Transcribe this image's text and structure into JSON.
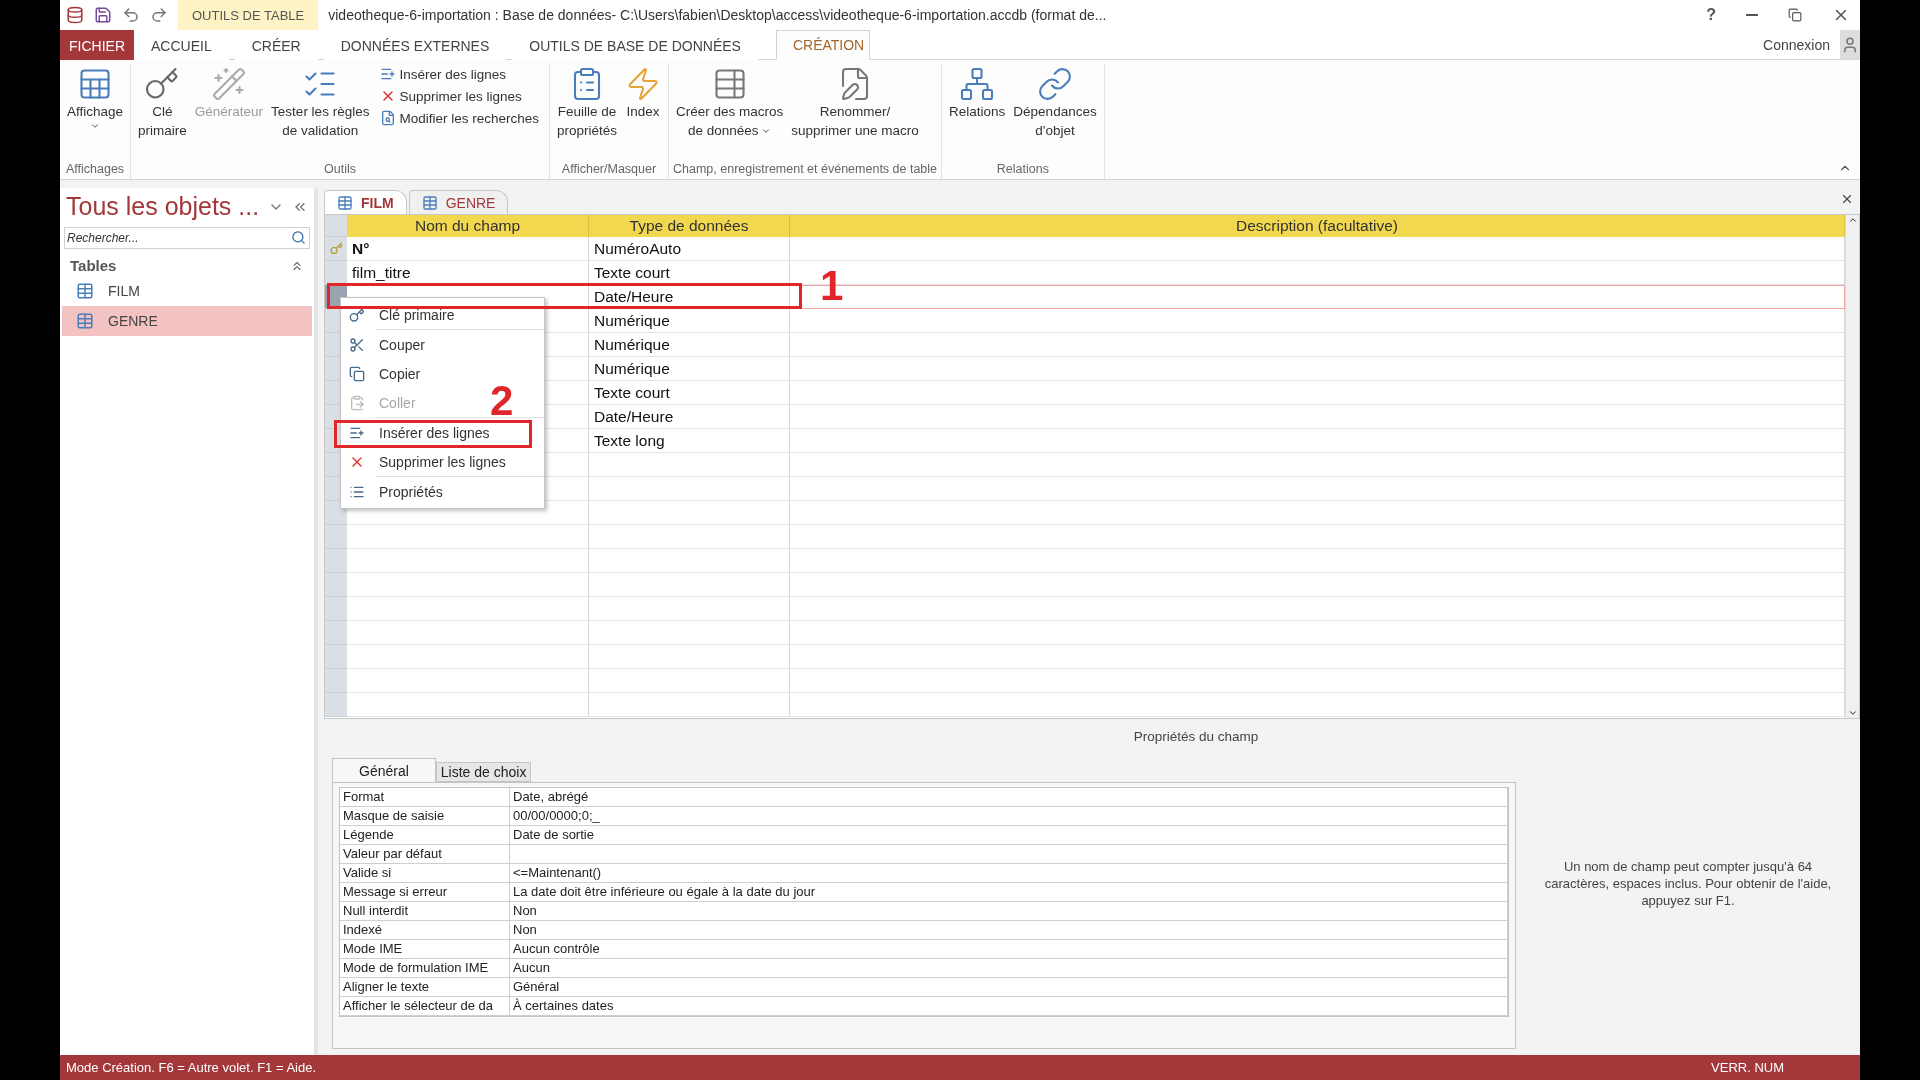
{
  "title_bar": {
    "contextual_tab": "OUTILS DE TABLE",
    "title": "videotheque-6-importation : Base de données- C:\\Users\\fabien\\Desktop\\access\\videotheque-6-importation.accdb (format de...",
    "help": "?"
  },
  "ribbon_tabs": [
    {
      "label": "FICHIER",
      "kind": "file",
      "selected": false
    },
    {
      "label": "ACCUEIL",
      "kind": "tab",
      "selected": false
    },
    {
      "label": "CRÉER",
      "kind": "tab",
      "selected": false
    },
    {
      "label": "DONNÉES EXTERNES",
      "kind": "tab",
      "selected": false
    },
    {
      "label": "OUTILS DE BASE DE DONNÉES",
      "kind": "tab",
      "selected": false
    },
    {
      "label": "CRÉATION",
      "kind": "contextual",
      "selected": true
    }
  ],
  "account": "Connexion",
  "ribbon_groups": [
    {
      "label": "Affichages",
      "buttons": [
        {
          "kind": "large",
          "lines": [
            "Affichage"
          ],
          "dropdown": true,
          "disabled": false
        }
      ]
    },
    {
      "label": "Outils",
      "buttons": [
        {
          "kind": "large",
          "lines": [
            "Clé",
            "primaire"
          ],
          "disabled": false
        },
        {
          "kind": "large",
          "lines": [
            "Générateur"
          ],
          "disabled": true
        },
        {
          "kind": "large",
          "lines": [
            "Tester les règles",
            "de validation"
          ],
          "disabled": false
        },
        {
          "kind": "small",
          "lines": [
            "Insérer des lignes"
          ],
          "disabled": false
        },
        {
          "kind": "small",
          "lines": [
            "Supprimer les lignes"
          ],
          "disabled": false
        },
        {
          "kind": "small",
          "lines": [
            "Modifier les recherches"
          ],
          "disabled": false
        }
      ]
    },
    {
      "label": "Afficher/Masquer",
      "buttons": [
        {
          "kind": "large",
          "lines": [
            "Feuille de",
            "propriétés"
          ],
          "disabled": false
        },
        {
          "kind": "large",
          "lines": [
            "Index"
          ],
          "disabled": false
        }
      ]
    },
    {
      "label": "Champ, enregistrement et événements de table",
      "buttons": [
        {
          "kind": "large",
          "lines": [
            "Créer des macros",
            "de données"
          ],
          "dropdown": true,
          "disabled": false
        },
        {
          "kind": "large",
          "lines": [
            "Renommer/",
            "supprimer une macro"
          ],
          "disabled": false
        }
      ]
    },
    {
      "label": "Relations",
      "buttons": [
        {
          "kind": "large",
          "lines": [
            "Relations"
          ],
          "disabled": false
        },
        {
          "kind": "large",
          "lines": [
            "Dépendances",
            "d'objet"
          ],
          "disabled": false
        }
      ]
    }
  ],
  "navigation": {
    "title": "Tous les objets ...",
    "search_placeholder": "Rechercher...",
    "group": "Tables",
    "items": [
      {
        "label": "FILM",
        "selected": false
      },
      {
        "label": "GENRE",
        "selected": true
      }
    ]
  },
  "document_tabs": [
    {
      "label": "FILM",
      "selected": true
    },
    {
      "label": "GENRE",
      "selected": false
    }
  ],
  "field_grid": {
    "columns": [
      "Nom du champ",
      "Type de données",
      "Description (facultative)"
    ],
    "rows": [
      {
        "field_name": "N°",
        "data_type": "NuméroAuto",
        "primary_key": true,
        "selected": false
      },
      {
        "field_name": "film_titre",
        "data_type": "Texte court",
        "selected": false
      },
      {
        "data_type": "Date/Heure",
        "selected": true
      },
      {
        "data_type": "Numérique",
        "selected": false
      },
      {
        "data_type": "Numérique",
        "selected": false
      },
      {
        "data_type": "Numérique",
        "selected": false
      },
      {
        "data_type": "Texte court",
        "selected": false
      },
      {
        "data_type": "Date/Heure",
        "selected": false
      },
      {
        "data_type": "Texte long",
        "selected": false
      }
    ]
  },
  "context_menu": [
    {
      "label": "Clé primaire",
      "disabled": false
    },
    {
      "label": "Couper",
      "disabled": false
    },
    {
      "label": "Copier",
      "disabled": false
    },
    {
      "label": "Coller",
      "disabled": true
    },
    {
      "label": "Insérer des lignes",
      "disabled": false
    },
    {
      "label": "Supprimer les lignes",
      "disabled": false
    },
    {
      "label": "Propriétés",
      "disabled": false
    }
  ],
  "annotations": [
    {
      "number": "1"
    },
    {
      "number": "2"
    }
  ],
  "field_properties": {
    "title": "Propriétés du champ",
    "tabs": [
      {
        "label": "Général",
        "selected": true
      },
      {
        "label": "Liste de choix",
        "selected": false
      }
    ],
    "rows": [
      {
        "label": "Format",
        "value": "Date, abrégé"
      },
      {
        "label": "Masque de saisie",
        "value": "00/00/0000;0;_"
      },
      {
        "label": "Légende",
        "value": "Date de sortie"
      },
      {
        "label": "Valeur par défaut"
      },
      {
        "label": "Valide si",
        "value": "<=Maintenant()"
      },
      {
        "label": "Message si erreur",
        "value": "La date doit être inférieure ou égale à la date du jour"
      },
      {
        "label": "Null interdit",
        "value": "Non"
      },
      {
        "label": "Indexé",
        "value": "Non"
      },
      {
        "label": "Mode IME",
        "value": "Aucun contrôle"
      },
      {
        "label": "Mode de formulation IME",
        "value": "Aucun"
      },
      {
        "label": "Aligner le texte",
        "value": "Général"
      },
      {
        "label": "Afficher le sélecteur de da",
        "value": "À certaines dates"
      }
    ],
    "help": "Un nom de champ peut compter jusqu'à 64 caractères, espaces inclus. Pour obtenir de l'aide, appuyez sur F1."
  },
  "status_bar": {
    "text": "Mode Création. F6 = Autre volet. F1 = Aide.",
    "indicator": "VERR. NUM"
  }
}
